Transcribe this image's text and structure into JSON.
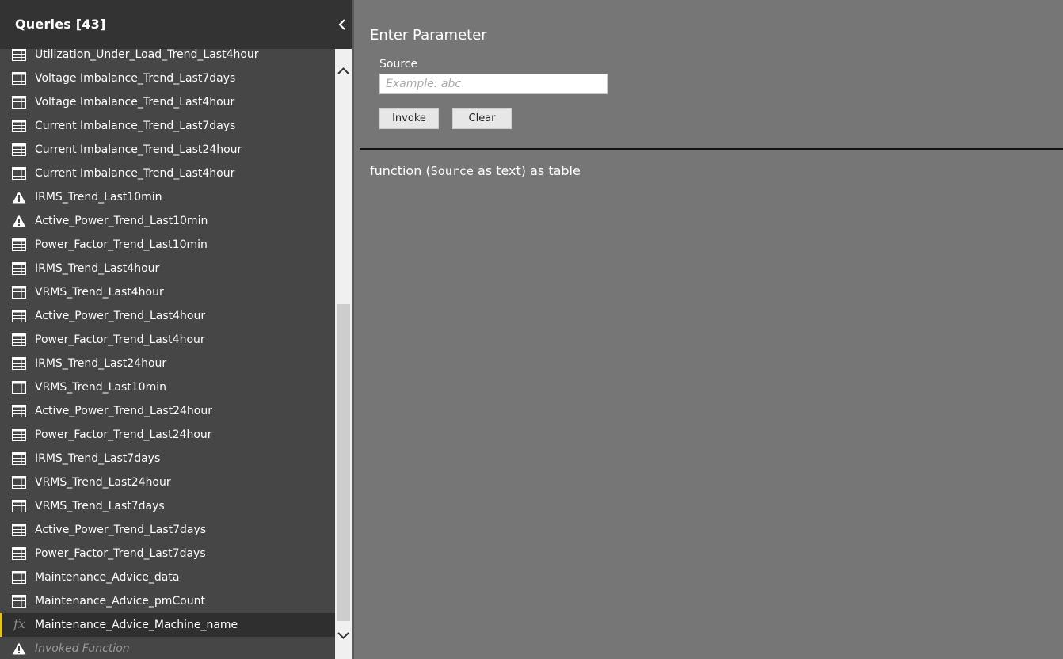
{
  "queries_pane": {
    "title": "Queries [43]",
    "items": [
      {
        "label": "Utilization_Under_Load_Trend_Last4hour",
        "icon": "table-icon"
      },
      {
        "label": "Voltage Imbalance_Trend_Last7days",
        "icon": "table-icon"
      },
      {
        "label": "Voltage Imbalance_Trend_Last4hour",
        "icon": "table-icon"
      },
      {
        "label": "Current Imbalance_Trend_Last7days",
        "icon": "table-icon"
      },
      {
        "label": "Current Imbalance_Trend_Last24hour",
        "icon": "table-icon"
      },
      {
        "label": "Current Imbalance_Trend_Last4hour",
        "icon": "table-icon"
      },
      {
        "label": "IRMS_Trend_Last10min",
        "icon": "warning-icon"
      },
      {
        "label": "Active_Power_Trend_Last10min",
        "icon": "warning-icon"
      },
      {
        "label": "Power_Factor_Trend_Last10min",
        "icon": "table-icon"
      },
      {
        "label": "IRMS_Trend_Last4hour",
        "icon": "table-icon"
      },
      {
        "label": "VRMS_Trend_Last4hour",
        "icon": "table-icon"
      },
      {
        "label": "Active_Power_Trend_Last4hour",
        "icon": "table-icon"
      },
      {
        "label": "Power_Factor_Trend_Last4hour",
        "icon": "table-icon"
      },
      {
        "label": "IRMS_Trend_Last24hour",
        "icon": "table-icon"
      },
      {
        "label": "VRMS_Trend_Last10min",
        "icon": "table-icon"
      },
      {
        "label": "Active_Power_Trend_Last24hour",
        "icon": "table-icon"
      },
      {
        "label": "Power_Factor_Trend_Last24hour",
        "icon": "table-icon"
      },
      {
        "label": "IRMS_Trend_Last7days",
        "icon": "table-icon"
      },
      {
        "label": "VRMS_Trend_Last24hour",
        "icon": "table-icon"
      },
      {
        "label": "VRMS_Trend_Last7days",
        "icon": "table-icon"
      },
      {
        "label": "Active_Power_Trend_Last7days",
        "icon": "table-icon"
      },
      {
        "label": "Power_Factor_Trend_Last7days",
        "icon": "table-icon"
      },
      {
        "label": "Maintenance_Advice_data",
        "icon": "table-icon"
      },
      {
        "label": "Maintenance_Advice_pmCount",
        "icon": "table-icon"
      },
      {
        "label": "Maintenance_Advice_Machine_name",
        "icon": "function-icon",
        "selected": true
      },
      {
        "label": "Invoked Function",
        "icon": "warning-icon",
        "muted": true
      }
    ]
  },
  "parameter_panel": {
    "title": "Enter Parameter",
    "source_label": "Source",
    "source_placeholder": "Example: abc",
    "source_value": "",
    "invoke_label": "Invoke",
    "clear_label": "Clear"
  },
  "signature": {
    "prefix": "function (",
    "param_name": "Source",
    "suffix": " as text) as table"
  },
  "colors": {
    "pane_background": "#464646",
    "pane_header": "#333333",
    "content_background": "#767676",
    "selection_accent": "#e8c319"
  }
}
